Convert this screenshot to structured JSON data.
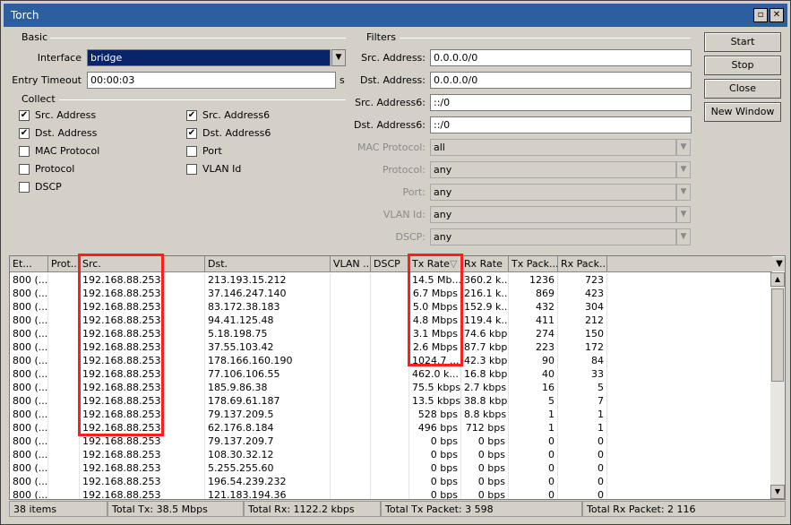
{
  "window": {
    "title": "Torch",
    "restore_glyph": "▫",
    "close_glyph": "✕"
  },
  "basic": {
    "label": "Basic",
    "interface_label": "Interface",
    "interface_value": "bridge",
    "entry_timeout_label": "Entry Timeout",
    "entry_timeout_value": "00:00:03",
    "entry_timeout_unit": "s"
  },
  "collect": {
    "label": "Collect",
    "items": [
      {
        "label": "Src. Address",
        "checked": true
      },
      {
        "label": "Dst. Address",
        "checked": true
      },
      {
        "label": "MAC Protocol",
        "checked": false
      },
      {
        "label": "Protocol",
        "checked": false
      },
      {
        "label": "DSCP",
        "checked": false
      },
      {
        "label": "Src. Address6",
        "checked": true
      },
      {
        "label": "Dst. Address6",
        "checked": true
      },
      {
        "label": "Port",
        "checked": false
      },
      {
        "label": "VLAN Id",
        "checked": false
      }
    ]
  },
  "filters": {
    "label": "Filters",
    "src_address_label": "Src. Address:",
    "src_address_value": "0.0.0.0/0",
    "dst_address_label": "Dst. Address:",
    "dst_address_value": "0.0.0.0/0",
    "src_address6_label": "Src. Address6:",
    "src_address6_value": "::/0",
    "dst_address6_label": "Dst. Address6:",
    "dst_address6_value": "::/0",
    "mac_protocol_label": "MAC Protocol:",
    "mac_protocol_value": "all",
    "protocol_label": "Protocol:",
    "protocol_value": "any",
    "port_label": "Port:",
    "port_value": "any",
    "vlan_id_label": "VLAN Id:",
    "vlan_id_value": "any",
    "dscp_label": "DSCP:",
    "dscp_value": "any"
  },
  "buttons": {
    "start": "Start",
    "stop": "Stop",
    "close": "Close",
    "new_window": "New Window"
  },
  "table": {
    "columns": [
      "Et...",
      "Prot...",
      "Src.",
      "Dst.",
      "VLAN ...",
      "DSCP",
      "Tx Rate",
      "Rx Rate",
      "Tx Pack...",
      "Rx Pack..."
    ],
    "sort_glyph": "▽",
    "menu_glyph": "▼",
    "rows": [
      [
        "800 (...",
        "",
        "192.168.88.253",
        "213.193.15.212",
        "",
        "",
        "14.5 Mb...",
        "360.2 k...",
        "1236",
        "723"
      ],
      [
        "800 (...",
        "",
        "192.168.88.253",
        "37.146.247.140",
        "",
        "",
        "6.7 Mbps",
        "216.1 k...",
        "869",
        "423"
      ],
      [
        "800 (...",
        "",
        "192.168.88.253",
        "83.172.38.183",
        "",
        "",
        "5.0 Mbps",
        "152.9 k...",
        "432",
        "304"
      ],
      [
        "800 (...",
        "",
        "192.168.88.253",
        "94.41.125.48",
        "",
        "",
        "4.8 Mbps",
        "119.4 k...",
        "411",
        "212"
      ],
      [
        "800 (...",
        "",
        "192.168.88.253",
        "5.18.198.75",
        "",
        "",
        "3.1 Mbps",
        "74.6 kbps",
        "274",
        "150"
      ],
      [
        "800 (...",
        "",
        "192.168.88.253",
        "37.55.103.42",
        "",
        "",
        "2.6 Mbps",
        "87.7 kbps",
        "223",
        "172"
      ],
      [
        "800 (...",
        "",
        "192.168.88.253",
        "178.166.160.190",
        "",
        "",
        "1024.7 ...",
        "42.3 kbps",
        "90",
        "84"
      ],
      [
        "800 (...",
        "",
        "192.168.88.253",
        "77.106.106.55",
        "",
        "",
        "462.0 k...",
        "16.8 kbps",
        "40",
        "33"
      ],
      [
        "800 (...",
        "",
        "192.168.88.253",
        "185.9.86.38",
        "",
        "",
        "75.5 kbps",
        "2.7 kbps",
        "16",
        "5"
      ],
      [
        "800 (...",
        "",
        "192.168.88.253",
        "178.69.61.187",
        "",
        "",
        "13.5 kbps",
        "38.8 kbps",
        "5",
        "7"
      ],
      [
        "800 (...",
        "",
        "192.168.88.253",
        "79.137.209.5",
        "",
        "",
        "528 bps",
        "8.8 kbps",
        "1",
        "1"
      ],
      [
        "800 (...",
        "",
        "192.168.88.253",
        "62.176.8.184",
        "",
        "",
        "496 bps",
        "712 bps",
        "1",
        "1"
      ],
      [
        "800 (...",
        "",
        "192.168.88.253",
        "79.137.209.7",
        "",
        "",
        "0 bps",
        "0 bps",
        "0",
        "0"
      ],
      [
        "800 (...",
        "",
        "192.168.88.253",
        "108.30.32.12",
        "",
        "",
        "0 bps",
        "0 bps",
        "0",
        "0"
      ],
      [
        "800 (...",
        "",
        "192.168.88.253",
        "5.255.255.60",
        "",
        "",
        "0 bps",
        "0 bps",
        "0",
        "0"
      ],
      [
        "800 (...",
        "",
        "192.168.88.253",
        "196.54.239.232",
        "",
        "",
        "0 bps",
        "0 bps",
        "0",
        "0"
      ],
      [
        "800 (...",
        "",
        "192.168.88.253",
        "121.183.194.36",
        "",
        "",
        "0 bps",
        "0 bps",
        "0",
        "0"
      ]
    ]
  },
  "status": {
    "items": "38 items",
    "total_tx": "Total Tx: 38.5 Mbps",
    "total_rx": "Total Rx: 1122.2 kbps",
    "total_tx_packet": "Total Tx Packet: 3 598",
    "total_rx_packet": "Total Rx Packet: 2 116"
  },
  "colors": {
    "titlebar": "#2d5e9e",
    "highlight": "#ff1e1e",
    "selection": "#0a246a"
  }
}
